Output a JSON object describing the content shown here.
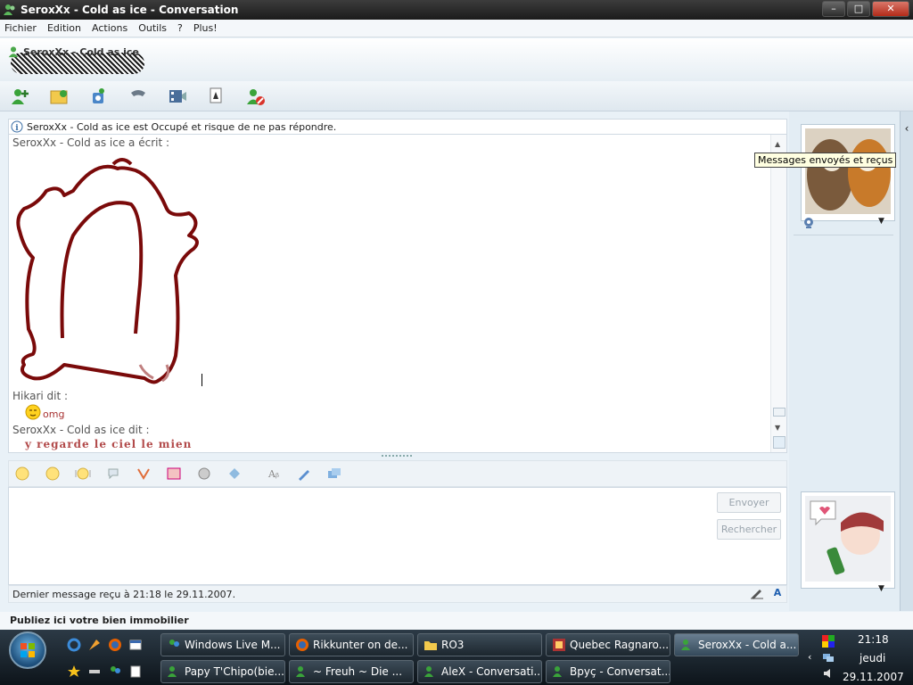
{
  "window": {
    "title": "SeroxXx - Cold as ice - Conversation"
  },
  "menu": [
    "Fichier",
    "Edition",
    "Actions",
    "Outils",
    "?",
    "Plus!"
  ],
  "contact": {
    "name": "SeroxXx - Cold as ice"
  },
  "toolbar": {
    "icons": [
      "invite-contact-icon",
      "share-files-icon",
      "video-call-icon",
      "call-icon",
      "video-icon",
      "games-icon",
      "block-icon"
    ]
  },
  "info": {
    "status_text": "SeroxXx - Cold as ice est Occupé et risque de ne pas répondre."
  },
  "history": {
    "messages": [
      {
        "who": "SeroxXx - Cold as ice a écrit :",
        "type": "handwriting"
      },
      {
        "who": "Hikari dit :",
        "text": "omg",
        "type": "text"
      },
      {
        "who": "SeroxXx - Cold as ice dit :",
        "text": "y regarde le ciel le mien",
        "type": "text"
      }
    ]
  },
  "tooltip": "Messages envoyés et reçus",
  "compose": {
    "send_label": "Envoyer",
    "search_label": "Rechercher"
  },
  "status_bar": {
    "last_message": "Dernier message reçu à 21:18 le 29.11.2007."
  },
  "ad": {
    "text": "Publiez ici votre bien immobilier"
  },
  "taskbar": {
    "row1": [
      "Windows Live M...",
      "Rikkunter on de...",
      "RO3",
      "Quebec Ragnaro...",
      "SeroxXx - Cold a..."
    ],
    "row2": [
      "Papy T'Chipo(bie...",
      "~ Freuh ~    Die ...",
      "AleX - Conversati...",
      "Bpyç - Conversat..."
    ],
    "clock_time": "21:18",
    "clock_day": "jeudi",
    "clock_date": "29.11.2007"
  },
  "colors": {
    "accent": "#1f5fb0",
    "drawing": "#7a0a0a",
    "message_highlight": "#a83232"
  }
}
